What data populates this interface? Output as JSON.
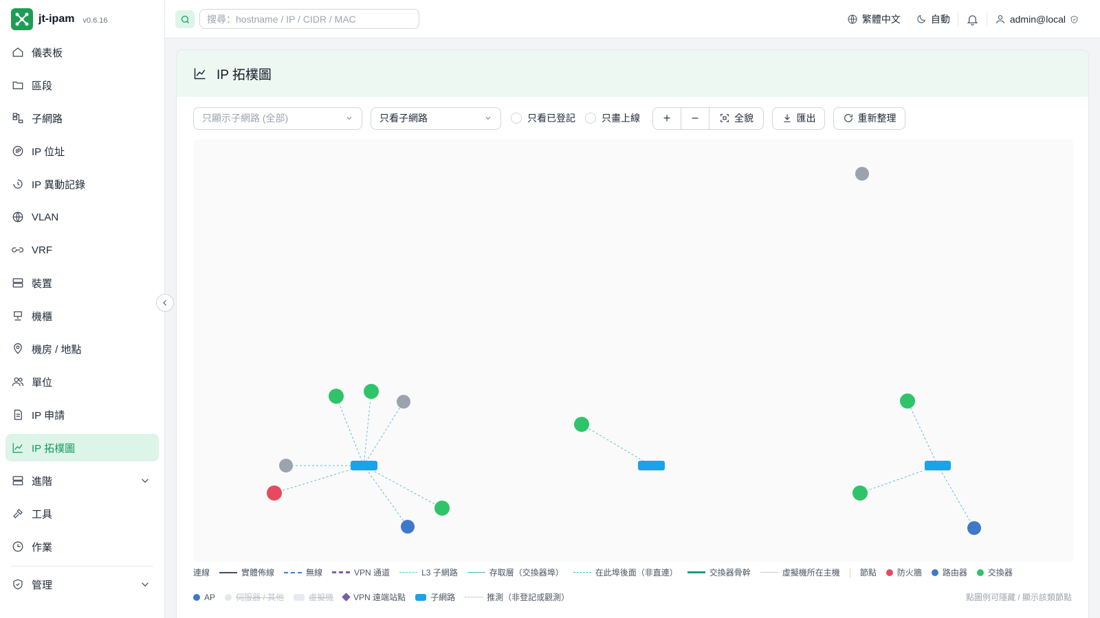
{
  "app": {
    "name": "jt-ipam",
    "version": "v0.6.16"
  },
  "sidebar": {
    "items": [
      {
        "label": "儀表板",
        "icon": "home-icon"
      },
      {
        "label": "區段",
        "icon": "folder-icon"
      },
      {
        "label": "子網路",
        "icon": "network-icon"
      },
      {
        "label": "IP 位址",
        "icon": "ip-icon"
      },
      {
        "label": "IP 異動記錄",
        "icon": "history-icon"
      },
      {
        "label": "VLAN",
        "icon": "globe-icon"
      },
      {
        "label": "VRF",
        "icon": "link-icon"
      },
      {
        "label": "裝置",
        "icon": "server-icon"
      },
      {
        "label": "機櫃",
        "icon": "rack-icon"
      },
      {
        "label": "機房 / 地點",
        "icon": "map-pin-icon"
      },
      {
        "label": "單位",
        "icon": "users-icon"
      },
      {
        "label": "IP 申請",
        "icon": "document-icon"
      },
      {
        "label": "IP 拓樸圖",
        "icon": "chart-icon"
      },
      {
        "label": "進階",
        "icon": "server-icon"
      },
      {
        "label": "工具",
        "icon": "hammer-icon"
      },
      {
        "label": "作業",
        "icon": "clock-icon"
      },
      {
        "label": "管理",
        "icon": "shield-icon"
      }
    ]
  },
  "topbar": {
    "search_placeholder": "搜尋：hostname / IP / CIDR / MAC",
    "language": "繁體中文",
    "theme": "自動",
    "user": "admin@local"
  },
  "page": {
    "title": "IP 拓樸圖"
  },
  "toolbar": {
    "filter_placeholder": "只顯示子網路 (全部)",
    "view_select": "只看子網路",
    "only_registered": "只看已登記",
    "only_online": "只畫上線",
    "zoom_in": "+",
    "zoom_out": "−",
    "fit": "全貌",
    "export": "匯出",
    "refresh": "重新整理"
  },
  "legend": {
    "links_title": "連線",
    "links": [
      "實體佈線",
      "無線",
      "VPN 通道",
      "L3 子網路",
      "存取層（交換器埠）",
      "在此埠後面（非直連）",
      "交換器骨幹",
      "虛擬機所在主機"
    ],
    "nodes_title": "節點",
    "nodes": [
      "防火牆",
      "路由器",
      "交換器",
      "AP",
      "伺服器 / 其他",
      "虛擬機",
      "VPN 遠端站點",
      "子網路",
      "推測（非登記或觀測）"
    ],
    "hint": "點圖例可隱藏 / 顯示該類節點"
  },
  "colors": {
    "accent": "#159a5c",
    "firewall": "#e64a5f",
    "router": "#3f78c9",
    "switch": "#2fc46a",
    "server": "#9ca3af",
    "subnet": "#1aa3e8",
    "vpn": "#7b5ea7"
  }
}
